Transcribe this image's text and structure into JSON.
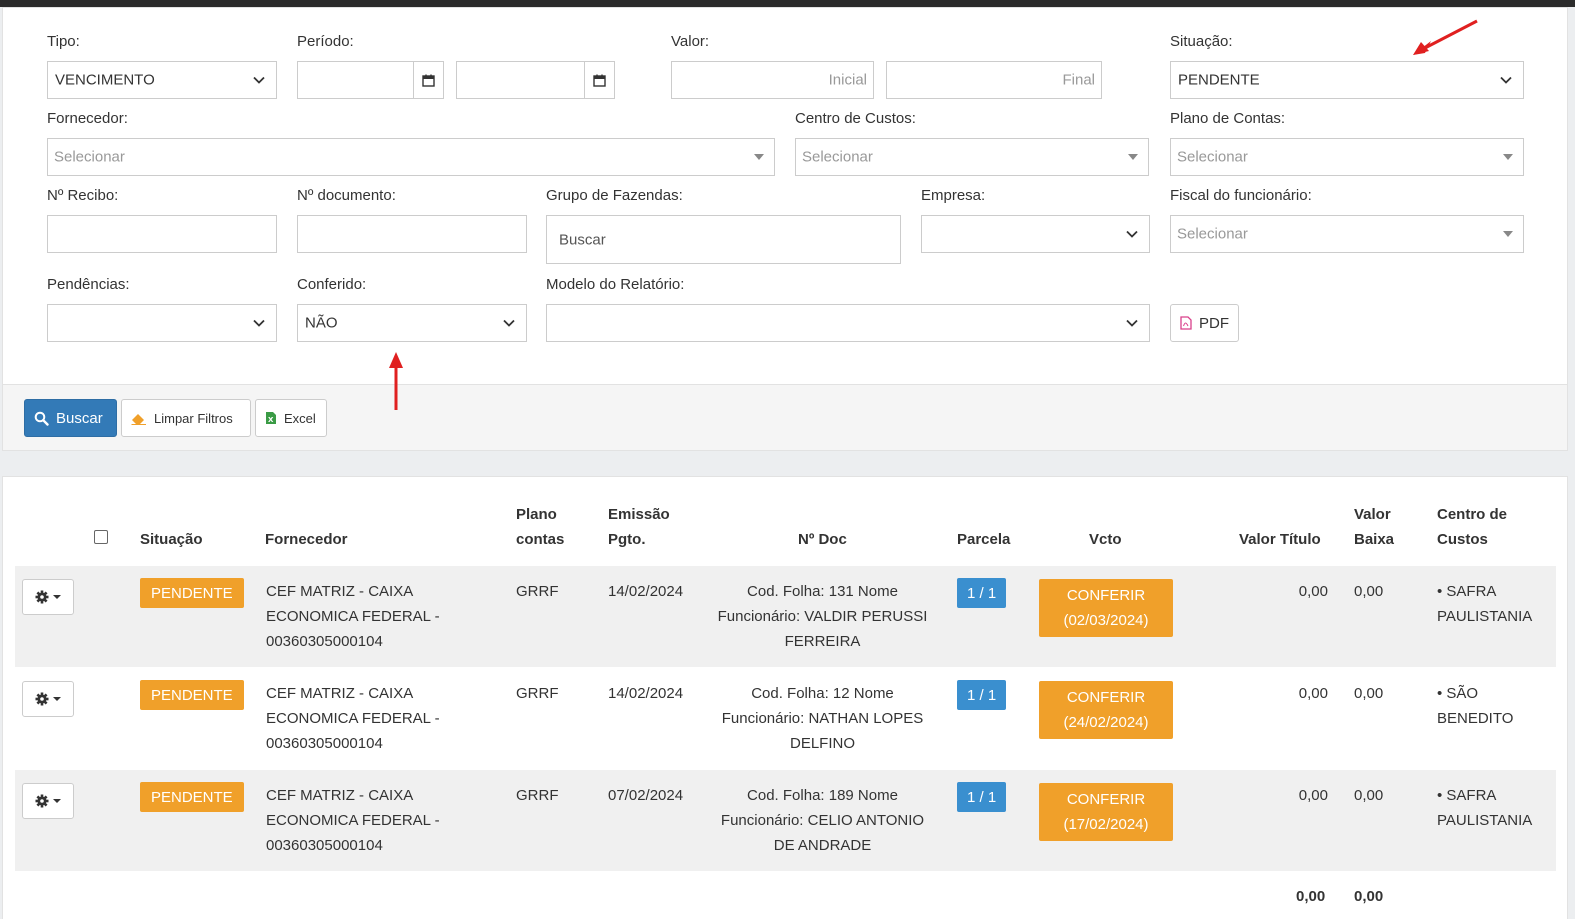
{
  "filters": {
    "tipo": {
      "label": "Tipo:",
      "value": "VENCIMENTO"
    },
    "periodo": {
      "label": "Período:"
    },
    "valor": {
      "label": "Valor:",
      "initial_placeholder": "Inicial",
      "final_placeholder": "Final"
    },
    "situacao": {
      "label": "Situação:",
      "value": "PENDENTE"
    },
    "fornecedor": {
      "label": "Fornecedor:",
      "placeholder": "Selecionar"
    },
    "centro_custos": {
      "label": "Centro de Custos:",
      "placeholder": "Selecionar"
    },
    "plano_contas": {
      "label": "Plano de Contas:",
      "placeholder": "Selecionar"
    },
    "recibo": {
      "label": "Nº Recibo:"
    },
    "documento": {
      "label": "Nº documento:"
    },
    "grupo_fazendas": {
      "label": "Grupo de Fazendas:",
      "placeholder": "Buscar"
    },
    "empresa": {
      "label": "Empresa:"
    },
    "fiscal": {
      "label": "Fiscal do funcionário:",
      "placeholder": "Selecionar"
    },
    "pendencias": {
      "label": "Pendências:"
    },
    "conferido": {
      "label": "Conferido:",
      "value": "NÃO"
    },
    "modelo_relatorio": {
      "label": "Modelo do Relatório:"
    },
    "pdf_label": "PDF"
  },
  "actions": {
    "buscar": "Buscar",
    "limpar": "Limpar Filtros",
    "excel": "Excel"
  },
  "table": {
    "headers": {
      "situacao": "Situação",
      "fornecedor": "Fornecedor",
      "plano_l1": "Plano",
      "plano_l2": "contas",
      "emissao_l1": "Emissão",
      "emissao_l2": "Pgto.",
      "ndoc": "Nº Doc",
      "parcela": "Parcela",
      "vcto": "Vcto",
      "valor_titulo": "Valor Título",
      "valor_baixa_l1": "Valor",
      "valor_baixa_l2": "Baixa",
      "centro_l1": "Centro de",
      "centro_l2": "Custos"
    },
    "rows": [
      {
        "situacao": "PENDENTE",
        "fornecedor": [
          "CEF MATRIZ - CAIXA",
          "ECONOMICA FEDERAL -",
          "00360305000104"
        ],
        "plano": "GRRF",
        "emissao": "14/02/2024",
        "ndoc": [
          "Cod. Folha: 131 Nome",
          "Funcionário: VALDIR PERUSSI",
          "FERREIRA"
        ],
        "parcela": "1 / 1",
        "conferir": "CONFERIR",
        "vcto": "(02/03/2024)",
        "valor_titulo": "0,00",
        "valor_baixa": "0,00",
        "centro": [
          "• SAFRA",
          "PAULISTANIA"
        ]
      },
      {
        "situacao": "PENDENTE",
        "fornecedor": [
          "CEF MATRIZ - CAIXA",
          "ECONOMICA FEDERAL -",
          "00360305000104"
        ],
        "plano": "GRRF",
        "emissao": "14/02/2024",
        "ndoc": [
          "Cod. Folha: 12 Nome",
          "Funcionário: NATHAN LOPES",
          "DELFINO"
        ],
        "parcela": "1 / 1",
        "conferir": "CONFERIR",
        "vcto": "(24/02/2024)",
        "valor_titulo": "0,00",
        "valor_baixa": "0,00",
        "centro": [
          "• SÃO",
          "BENEDITO"
        ]
      },
      {
        "situacao": "PENDENTE",
        "fornecedor": [
          "CEF MATRIZ - CAIXA",
          "ECONOMICA FEDERAL -",
          "00360305000104"
        ],
        "plano": "GRRF",
        "emissao": "07/02/2024",
        "ndoc": [
          "Cod. Folha: 189 Nome",
          "Funcionário: CELIO ANTONIO",
          "DE ANDRADE"
        ],
        "parcela": "1 / 1",
        "conferir": "CONFERIR",
        "vcto": "(17/02/2024)",
        "valor_titulo": "0,00",
        "valor_baixa": "0,00",
        "centro": [
          "• SAFRA",
          "PAULISTANIA"
        ]
      }
    ],
    "totals": {
      "valor_titulo": "0,00",
      "valor_baixa": "0,00"
    }
  },
  "colors": {
    "primary": "#337ab7",
    "pending": "#f0a02a",
    "parcela": "#3a8fcf",
    "arrow": "#e02020"
  }
}
